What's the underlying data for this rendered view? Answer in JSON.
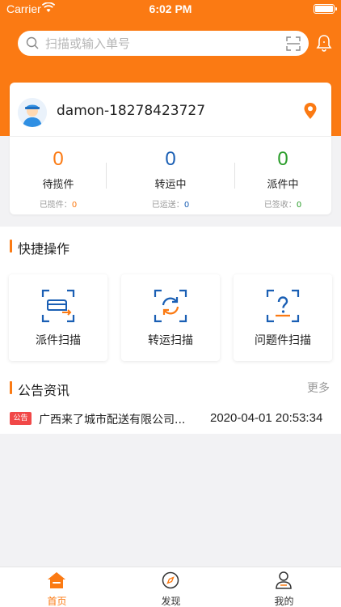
{
  "status_bar": {
    "carrier": "Carrier",
    "time": "6:02 PM"
  },
  "search": {
    "placeholder": "扫描或输入单号"
  },
  "user": {
    "name": "damon-18278423727"
  },
  "stats": [
    {
      "count": "0",
      "label": "待揽件",
      "sub_label": "已揽件：",
      "sub_value": "0",
      "color": "#fb7a13"
    },
    {
      "count": "0",
      "label": "转运中",
      "sub_label": "已运送：",
      "sub_value": "0",
      "color": "#1a5fb4"
    },
    {
      "count": "0",
      "label": "派件中",
      "sub_label": "已签收：",
      "sub_value": "0",
      "color": "#2a9d2a"
    }
  ],
  "quick_actions": {
    "title": "快捷操作",
    "items": [
      {
        "label": "派件扫描",
        "icon": "dispatch-scan-icon"
      },
      {
        "label": "转运扫描",
        "icon": "transfer-scan-icon"
      },
      {
        "label": "问题件扫描",
        "icon": "problem-scan-icon"
      }
    ]
  },
  "notices": {
    "title": "公告资讯",
    "more": "更多",
    "items": [
      {
        "badge": "公告",
        "text": "广西来了城市配送有限公司...",
        "time": "2020-04-01 20:53:34"
      }
    ]
  },
  "tabbar": {
    "tabs": [
      {
        "label": "首页",
        "icon": "home-icon",
        "active": true
      },
      {
        "label": "发现",
        "icon": "compass-icon",
        "active": false
      },
      {
        "label": "我的",
        "icon": "profile-icon",
        "active": false
      }
    ]
  },
  "colors": {
    "accent": "#fb7a13",
    "icon_blue": "#1a5fb4",
    "badge_red": "#f14848"
  }
}
